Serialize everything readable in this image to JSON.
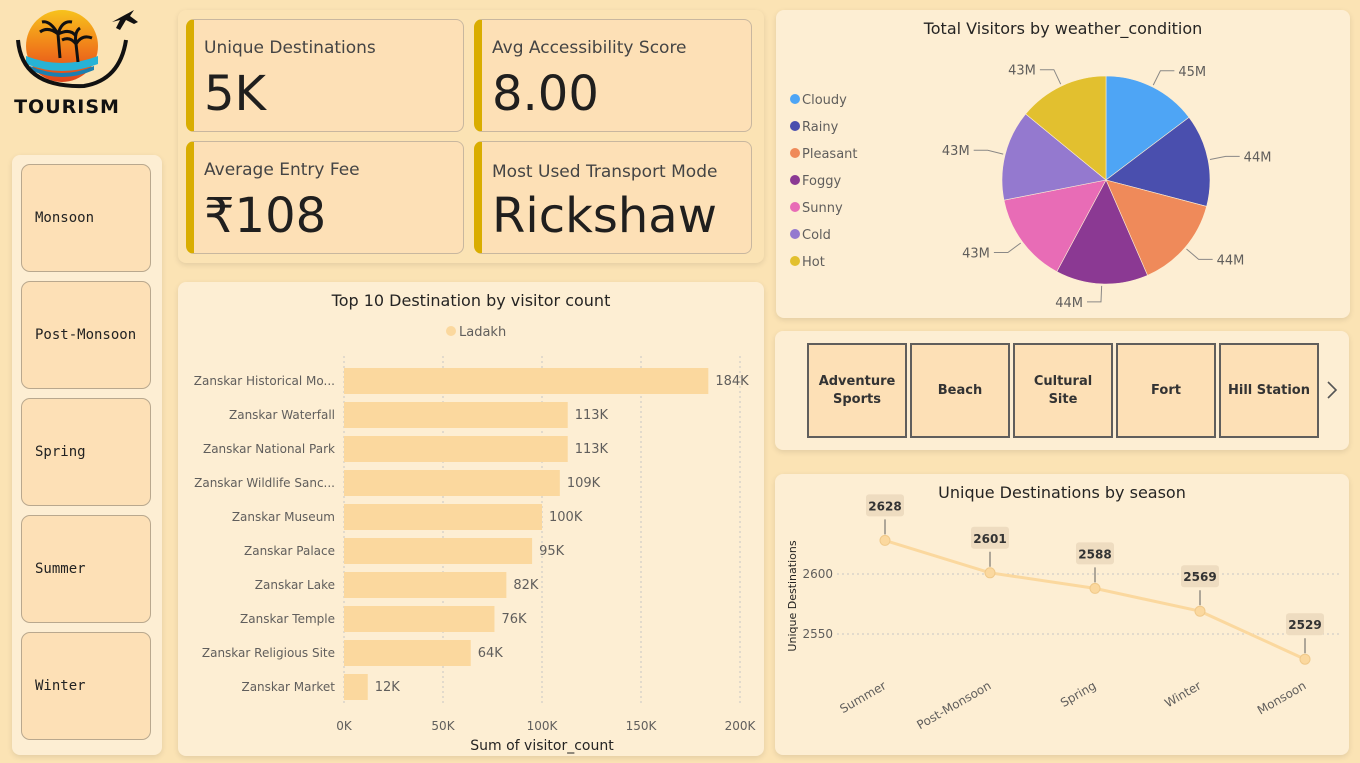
{
  "logo": {
    "text": "TOURISM"
  },
  "season_slicer": {
    "items": [
      "Monsoon",
      "Post-Monsoon",
      "Spring",
      "Summer",
      "Winter"
    ]
  },
  "kpis": {
    "unique_destinations": {
      "label": "Unique Destinations",
      "value": "5K"
    },
    "avg_accessibility": {
      "label": "Avg Accessibility Score",
      "value": "8.00"
    },
    "avg_entry_fee": {
      "label": "Average Entry Fee",
      "value": "₹108"
    },
    "transport_mode": {
      "label": "Most Used Transport Mode",
      "value": "Rickshaw"
    }
  },
  "category_slicer": {
    "items": [
      "Adventure Sports",
      "Beach",
      "Cultural Site",
      "Fort",
      "Hill Station"
    ],
    "next_icon": "chevron-right-icon"
  },
  "colors": {
    "background": "#fbe3b4",
    "panel": "#fdeed3",
    "bar": "#fbd89e",
    "line": "#fbd89e",
    "kpi_accent": "#d9ad00"
  },
  "chart_data": [
    {
      "type": "bar",
      "orientation": "horizontal",
      "title": "Top 10 Destination by visitor count",
      "legend": [
        "Ladakh"
      ],
      "legend_position": "top-center",
      "xlabel": "Sum of visitor_count",
      "ylabel": "",
      "categories": [
        "Zanskar Historical Mo...",
        "Zanskar Waterfall",
        "Zanskar National Park",
        "Zanskar Wildlife Sanc...",
        "Zanskar Museum",
        "Zanskar Palace",
        "Zanskar Lake",
        "Zanskar Temple",
        "Zanskar Religious Site",
        "Zanskar Market"
      ],
      "values": [
        184000,
        113000,
        113000,
        109000,
        100000,
        95000,
        82000,
        76000,
        64000,
        12000
      ],
      "data_labels": [
        "184K",
        "113K",
        "113K",
        "109K",
        "100K",
        "95K",
        "82K",
        "76K",
        "64K",
        "12K"
      ],
      "xticks": [
        "0K",
        "50K",
        "100K",
        "150K",
        "200K"
      ],
      "xlim": [
        0,
        200000
      ],
      "grid": true
    },
    {
      "type": "pie",
      "title": "Total Visitors by weather_condition",
      "legend_position": "left",
      "labels": [
        "Cloudy",
        "Rainy",
        "Pleasant",
        "Foggy",
        "Sunny",
        "Cold",
        "Hot"
      ],
      "values": [
        45,
        44,
        44,
        44,
        43,
        43,
        43
      ],
      "data_labels": [
        "45M",
        "44M",
        "44M",
        "44M",
        "43M",
        "43M",
        "43M"
      ],
      "colors": [
        "#4ea5f5",
        "#4a4fae",
        "#ef8a5a",
        "#8b3993",
        "#e86cb6",
        "#9479cf",
        "#e2c02f"
      ]
    },
    {
      "type": "line",
      "title": "Unique Destinations by season",
      "xlabel": "",
      "ylabel": "Unique Destinations",
      "categories": [
        "Summer",
        "Post-Monsoon",
        "Spring",
        "Winter",
        "Monsoon"
      ],
      "values": [
        2628,
        2601,
        2588,
        2569,
        2529
      ],
      "yticks": [
        2550,
        2600
      ],
      "ylim": [
        2520,
        2640
      ],
      "grid": true
    }
  ]
}
